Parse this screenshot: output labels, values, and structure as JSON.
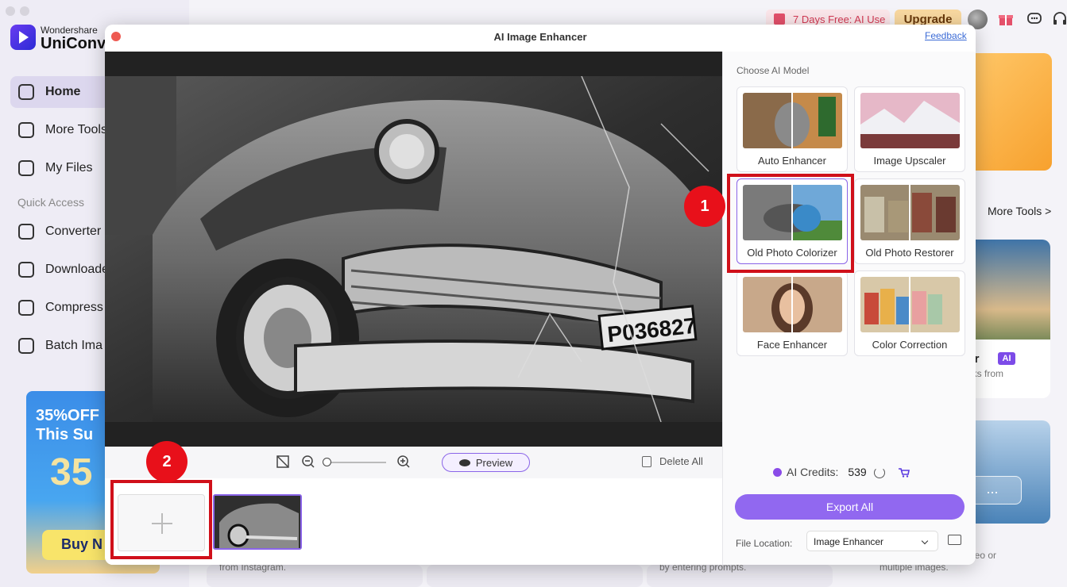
{
  "app": {
    "brand_top": "Wondershare",
    "brand_main": "UniConve"
  },
  "sidebar": {
    "items": [
      {
        "label": "Home",
        "icon": "home-icon"
      },
      {
        "label": "More Tools",
        "icon": "toolbox-icon"
      },
      {
        "label": "My Files",
        "icon": "files-icon"
      },
      {
        "label": "Converter",
        "icon": "converter-icon"
      },
      {
        "label": "Downloade",
        "icon": "download-icon"
      },
      {
        "label": "Compress",
        "icon": "compress-icon"
      },
      {
        "label": "Batch Ima",
        "icon": "image-icon"
      }
    ],
    "quick_access_label": "Quick Access",
    "promo": {
      "line1": "35%OFF",
      "line2": "This Su",
      "big": "35",
      "button": "Buy N"
    }
  },
  "topbar": {
    "trial": "7 Days Free: AI Use",
    "upgrade": "Upgrade"
  },
  "background": {
    "more_tools": "More Tools >",
    "card_title": "ver",
    "card_badge": "AI",
    "card_desc": "arks from",
    "dots": "...",
    "bottom_text_1": "from Instagram.",
    "bottom_text_2": "by entering prompts.",
    "bottom_text_3": "deo or",
    "bottom_text_4": "multiple images."
  },
  "modal": {
    "title": "AI Image Enhancer",
    "feedback": "Feedback",
    "preview_label": "Preview",
    "delete_all": "Delete All",
    "choose_label": "Choose AI Model",
    "models": [
      {
        "label": "Auto Enhancer",
        "selected": false
      },
      {
        "label": "Image Upscaler",
        "selected": false
      },
      {
        "label": "Old Photo Colorizer",
        "selected": true
      },
      {
        "label": "Old Photo Restorer",
        "selected": false
      },
      {
        "label": "Face Enhancer",
        "selected": false
      },
      {
        "label": "Color Correction",
        "selected": false
      }
    ],
    "credits_label": "AI Credits:",
    "credits_value": "539",
    "export": "Export All",
    "file_location_label": "File Location:",
    "file_location_value": "Image Enhancer",
    "plate_text": "P036827"
  },
  "annotations": {
    "badge1": "1",
    "badge2": "2"
  },
  "colors": {
    "accent": "#9168f0",
    "annotation": "#d0101a",
    "trial": "#d43a54"
  }
}
